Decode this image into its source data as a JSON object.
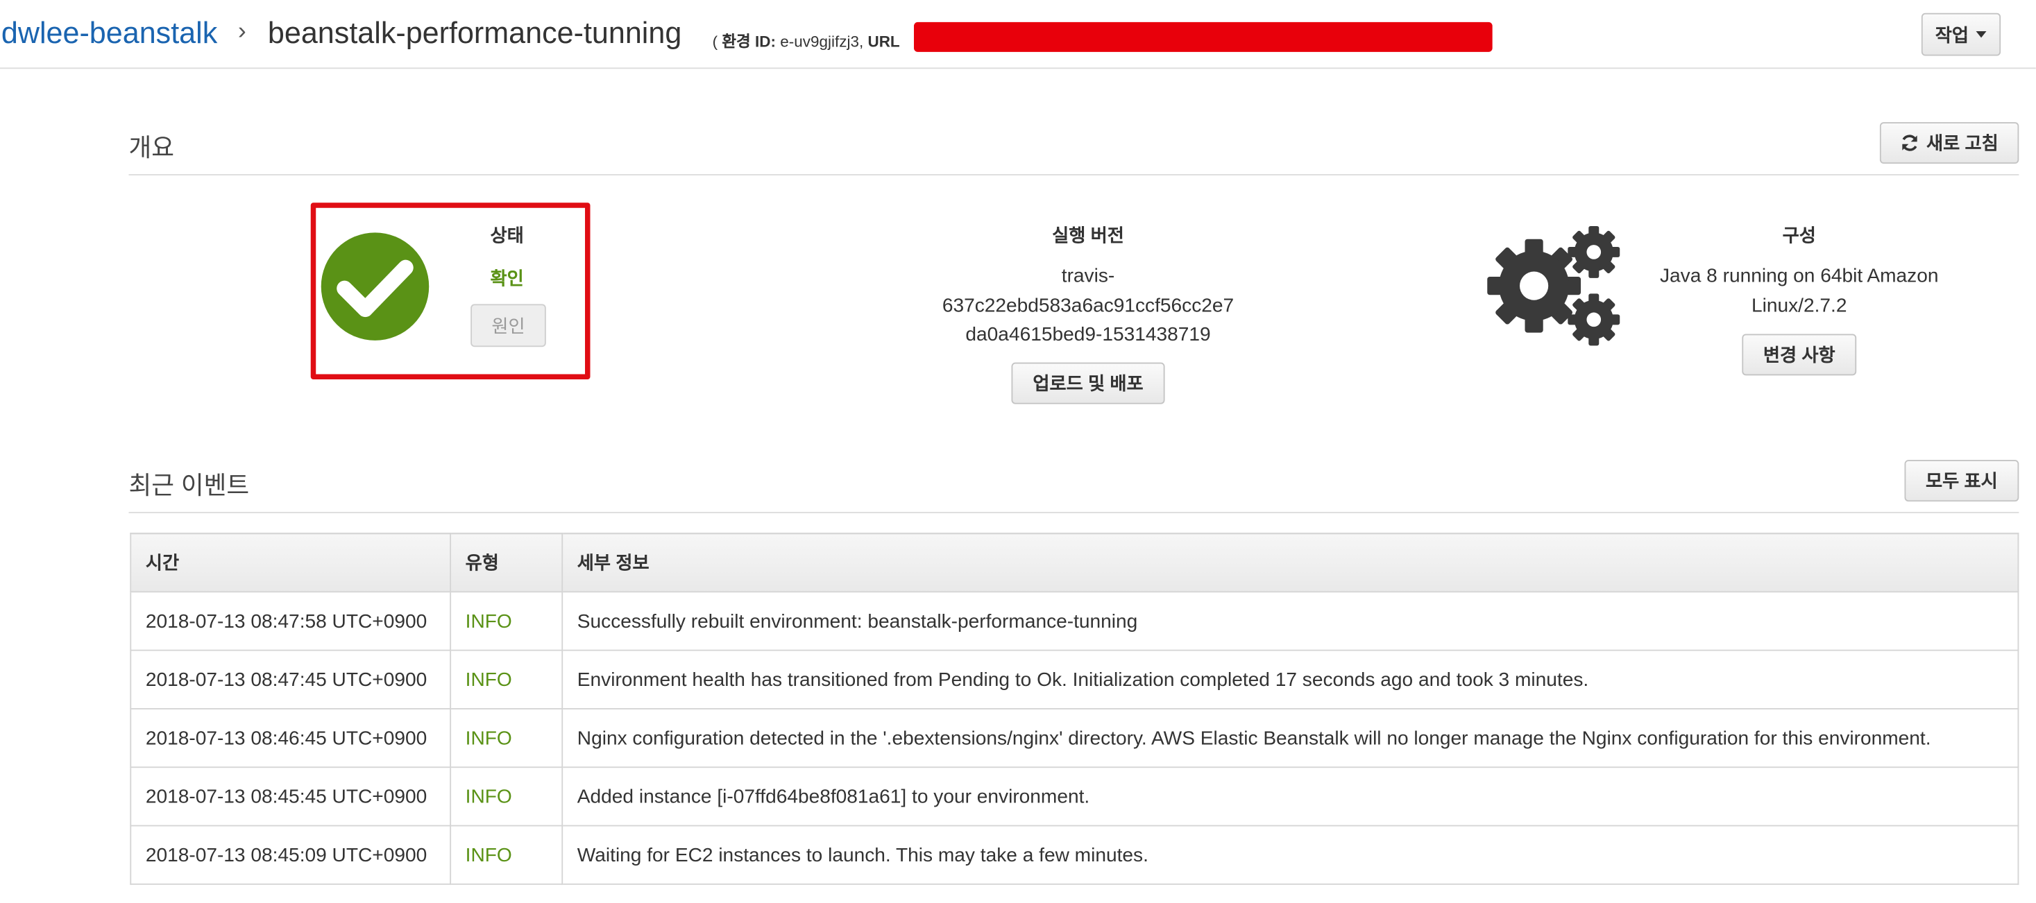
{
  "breadcrumb": {
    "app_name": "dwlee-beanstalk",
    "separator": "›",
    "environment_name": "beanstalk-performance-tunning",
    "env_id_prefix": "( ",
    "env_id_label": "환경 ID:",
    "env_id_value": "e-uv9gjifzj3,",
    "url_label": "URL"
  },
  "header": {
    "actions_label": "작업"
  },
  "overview": {
    "title": "개요",
    "refresh_label": "새로 고침",
    "health": {
      "title": "상태",
      "status": "확인",
      "cause_label": "원인"
    },
    "version": {
      "title": "실행 버전",
      "lines": [
        "travis-",
        "637c22ebd583a6ac91ccf56cc2e7",
        "da0a4615bed9-1531438719"
      ],
      "upload_label": "업로드 및 배포"
    },
    "configuration": {
      "title": "구성",
      "lines": [
        "Java 8 running on 64bit Amazon",
        "Linux/2.7.2"
      ],
      "changes_label": "변경 사항"
    }
  },
  "events": {
    "title": "최근 이벤트",
    "show_all_label": "모두 표시",
    "columns": [
      "시간",
      "유형",
      "세부 정보"
    ],
    "rows": [
      {
        "time": "2018-07-13 08:47:58 UTC+0900",
        "type": "INFO",
        "details": "Successfully rebuilt environment: beanstalk-performance-tunning"
      },
      {
        "time": "2018-07-13 08:47:45 UTC+0900",
        "type": "INFO",
        "details": "Environment health has transitioned from Pending to Ok. Initialization completed 17 seconds ago and took 3 minutes."
      },
      {
        "time": "2018-07-13 08:46:45 UTC+0900",
        "type": "INFO",
        "details": "Nginx configuration detected in the '.ebextensions/nginx' directory. AWS Elastic Beanstalk will no longer manage the Nginx configuration for this environment."
      },
      {
        "time": "2018-07-13 08:45:45 UTC+0900",
        "type": "INFO",
        "details": "Added instance [i-07ffd64be8f081a61] to your environment."
      },
      {
        "time": "2018-07-13 08:45:09 UTC+0900",
        "type": "INFO",
        "details": "Waiting for EC2 instances to launch. This may take a few minutes."
      }
    ]
  },
  "colors": {
    "link": "#1a64b0",
    "ok_green": "#5a9216",
    "highlight_red": "#e00d14",
    "redaction": "#e8000b",
    "gear_gray": "#3a3a3a"
  },
  "icons": {
    "health": "check-circle-icon",
    "refresh": "refresh-icon",
    "configuration": "gears-icon",
    "actions": "caret-down-icon"
  }
}
